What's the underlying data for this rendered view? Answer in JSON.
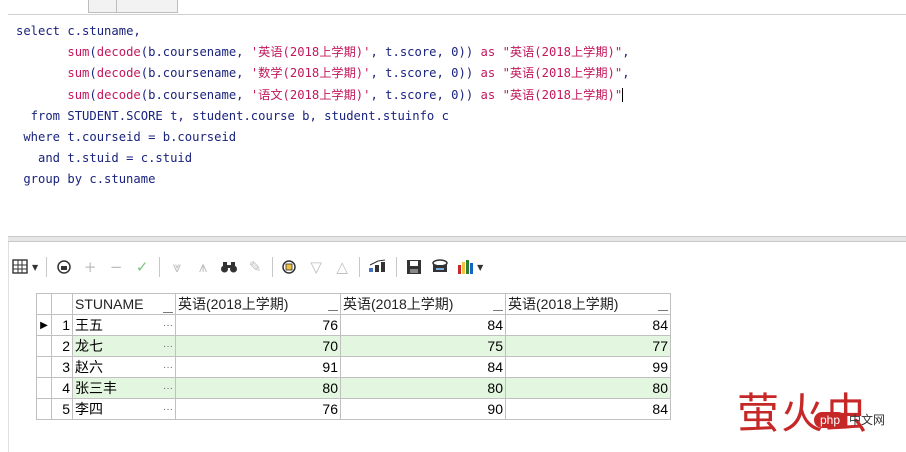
{
  "editor": {
    "lines": [
      [
        {
          "t": "select ",
          "c": "kw"
        },
        {
          "t": "c.stuname,",
          "c": "kw"
        }
      ],
      [
        {
          "t": "       ",
          "c": "kw"
        },
        {
          "t": "sum",
          "c": "fn"
        },
        {
          "t": "(",
          "c": "kw"
        },
        {
          "t": "decode",
          "c": "fn"
        },
        {
          "t": "(b.coursename, ",
          "c": "kw"
        },
        {
          "t": "'英语(2018上学期)'",
          "c": "str"
        },
        {
          "t": ", t.score, 0)) ",
          "c": "kw"
        },
        {
          "t": "as",
          "c": "fn"
        },
        {
          "t": " ",
          "c": "kw"
        },
        {
          "t": "\"英语(2018上学期)\"",
          "c": "str"
        },
        {
          "t": ",",
          "c": "kw"
        }
      ],
      [
        {
          "t": "       ",
          "c": "kw"
        },
        {
          "t": "sum",
          "c": "fn"
        },
        {
          "t": "(",
          "c": "kw"
        },
        {
          "t": "decode",
          "c": "fn"
        },
        {
          "t": "(b.coursename, ",
          "c": "kw"
        },
        {
          "t": "'数学(2018上学期)'",
          "c": "str"
        },
        {
          "t": ", t.score, 0)) ",
          "c": "kw"
        },
        {
          "t": "as",
          "c": "fn"
        },
        {
          "t": " ",
          "c": "kw"
        },
        {
          "t": "\"英语(2018上学期)\"",
          "c": "str"
        },
        {
          "t": ",",
          "c": "kw"
        }
      ],
      [
        {
          "t": "       ",
          "c": "kw"
        },
        {
          "t": "sum",
          "c": "fn"
        },
        {
          "t": "(",
          "c": "kw"
        },
        {
          "t": "decode",
          "c": "fn"
        },
        {
          "t": "(b.coursename, ",
          "c": "kw"
        },
        {
          "t": "'语文(2018上学期)'",
          "c": "str"
        },
        {
          "t": ", t.score, 0)) ",
          "c": "kw"
        },
        {
          "t": "as",
          "c": "fn"
        },
        {
          "t": " ",
          "c": "kw"
        },
        {
          "t": "\"英语(2018上学期)\"",
          "c": "str"
        }
      ],
      [
        {
          "t": "  from ",
          "c": "kw"
        },
        {
          "t": "STUDENT.SCORE t, student.course b, student.stuinfo c",
          "c": "kw"
        }
      ],
      [
        {
          "t": " where ",
          "c": "kw"
        },
        {
          "t": "t.courseid = b.courseid",
          "c": "kw"
        }
      ],
      [
        {
          "t": "   and ",
          "c": "kw"
        },
        {
          "t": "t.stuid = c.stuid",
          "c": "kw"
        }
      ],
      [
        {
          "t": " group by ",
          "c": "kw"
        },
        {
          "t": "c.stuname",
          "c": "kw"
        }
      ]
    ]
  },
  "toolbar": {
    "icons": [
      "grid-menu-icon",
      "lock-icon",
      "plus-icon",
      "minus-icon",
      "check-icon",
      "filter-down-icon",
      "filter-all-icon",
      "binoculars-icon",
      "clear-icon",
      "query-icon",
      "sort-down-icon",
      "sort-up-icon",
      "export-icon",
      "save-icon",
      "print-icon",
      "chart-icon"
    ]
  },
  "grid": {
    "columns": [
      "STUNAME",
      "英语(2018上学期)",
      "英语(2018上学期)",
      "英语(2018上学期)"
    ],
    "rows": [
      {
        "num": "1",
        "name": "王五",
        "dots": "···",
        "v1": "76",
        "v2": "84",
        "v3": "84"
      },
      {
        "num": "2",
        "name": "龙七",
        "dots": "···",
        "v1": "70",
        "v2": "75",
        "v3": "77"
      },
      {
        "num": "3",
        "name": "赵六",
        "dots": "···",
        "v1": "91",
        "v2": "84",
        "v3": "99"
      },
      {
        "num": "4",
        "name": "张三丰",
        "dots": "···",
        "v1": "80",
        "v2": "80",
        "v3": "80"
      },
      {
        "num": "5",
        "name": "李四",
        "dots": "···",
        "v1": "76",
        "v2": "90",
        "v3": "84"
      }
    ],
    "current_row_marker": "▶"
  },
  "watermark": {
    "main": "萤火虫",
    "badge": "php",
    "suffix": "中文网"
  },
  "colors": {
    "keyword": "#1a237e",
    "function": "#c2185b",
    "alt_row": "#e3f7e0",
    "watermark": "#c62828"
  }
}
